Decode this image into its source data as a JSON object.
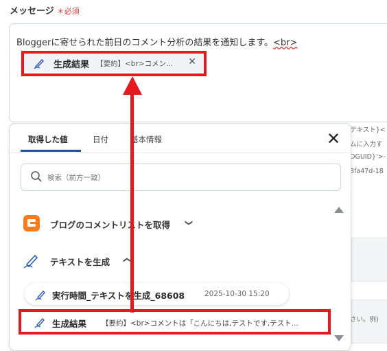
{
  "field": {
    "label": "メッセージ",
    "required": "＊必須"
  },
  "message": {
    "text": "Bloggerに寄せられた前日のコメント分析の結果を通知します。",
    "br_tag": "<br>"
  },
  "chip": {
    "icon": "pen-icon",
    "title": "生成結果",
    "value": "【要約】<br>コメン...",
    "remove": "✕"
  },
  "background_fragments": [
    "テキスト}<",
    "ムに入力す",
    "OGUID}'>-",
    "3fa47d-18",
    "さい。例)"
  ],
  "panel": {
    "tabs": [
      "取得した値",
      "日付",
      "基本情報"
    ],
    "active_tab": 0,
    "close": "✕",
    "search_placeholder": "検索（前方一致）",
    "sections": [
      {
        "icon": "blogger-icon",
        "label": "ブログのコメントリストを取得",
        "chevron": "❯"
      },
      {
        "icon": "pen-icon",
        "label": "テキストを生成",
        "chevron": "❯"
      }
    ],
    "items": [
      {
        "title": "実行時間_テキストを生成_68608",
        "value": "2025-10-30 15:20"
      },
      {
        "title": "生成結果",
        "value": "【要約】<br>コメントは「こんにちは,テストです,テスト..."
      }
    ]
  },
  "colors": {
    "highlight": "#e5191e",
    "blogger": "#f57d20",
    "tab_active": "#1f4e9e",
    "required": "#e03a3a"
  }
}
